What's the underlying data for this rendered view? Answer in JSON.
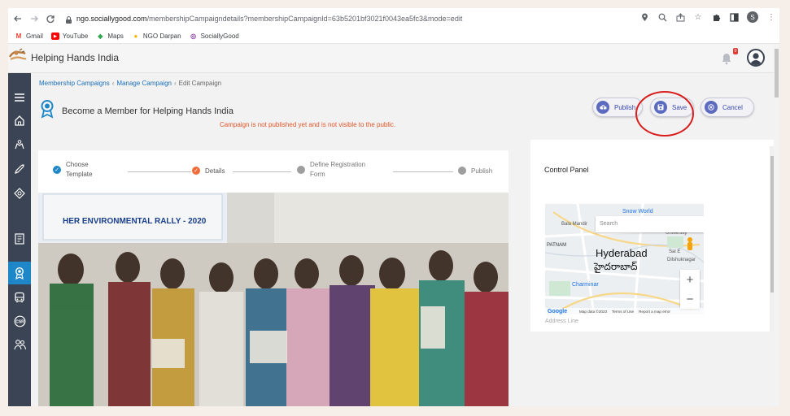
{
  "browser": {
    "url_host": "ngo.sociallygood.com",
    "url_path": "/membershipCampaigndetails?membershipCampaignId=63b5201bf3021f0043ea5fc3&mode=edit",
    "profile_initial": "S",
    "bookmarks": [
      {
        "label": "Gmail",
        "icon": "gmail-icon",
        "color": "#ea4335",
        "glyph": "M"
      },
      {
        "label": "YouTube",
        "icon": "youtube-icon",
        "color": "#ff0000",
        "glyph": "▶"
      },
      {
        "label": "Maps",
        "icon": "maps-icon",
        "color": "#34a853",
        "glyph": "◆"
      },
      {
        "label": "NGO Darpan",
        "icon": "ngo-darpan-icon",
        "color": "#f4b400",
        "glyph": "●"
      },
      {
        "label": "SociallyGood",
        "icon": "sociallygood-icon",
        "color": "#8e44ad",
        "glyph": "◎"
      }
    ]
  },
  "app": {
    "org_name": "Helping Hands India",
    "notification_count": "0",
    "accent": "#1d87c8",
    "rail_color": "#3b4454"
  },
  "breadcrumb": {
    "items": [
      "Membership Campaigns",
      "Manage Campaign"
    ],
    "current": "Edit Campaign"
  },
  "page": {
    "title": "Become a Member for Helping Hands India",
    "warning": "Campaign is not published yet and is not visible to the public.",
    "actions": {
      "publish": "Publish",
      "save": "Save",
      "cancel": "Cancel"
    }
  },
  "steps": [
    {
      "label_1": "Choose",
      "label_2": "Template",
      "state": "done"
    },
    {
      "label_1": "Details",
      "label_2": "",
      "state": "current"
    },
    {
      "label_1": "Define Registration",
      "label_2": "Form",
      "state": "pending"
    },
    {
      "label_1": "Publish",
      "label_2": "",
      "state": "pending"
    }
  ],
  "banner": {
    "title": "HER ENVIRONMENTAL RALLY - 2020"
  },
  "control_panel": {
    "title": "Control Panel",
    "map": {
      "search_placeholder": "Search",
      "city": "Hyderabad",
      "city_local": "హైదరాబాద్",
      "labels": [
        "Snow World",
        "Bala Mandir",
        "PATNAM",
        "Charminar",
        "University",
        "Dilshuknagar",
        "Sai E"
      ],
      "footer_brand": "Google",
      "footer_items": [
        "Map data ©2023",
        "Terms of Use",
        "Report a map error"
      ]
    },
    "address_label": "Address Line"
  }
}
